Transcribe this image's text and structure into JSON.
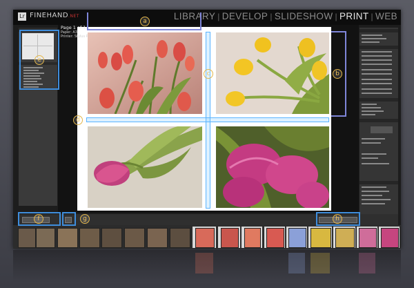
{
  "app": {
    "logo_mark": "Lr",
    "logo_text": "FINEHAND",
    "logo_suffix": ".NET"
  },
  "modules": [
    {
      "label": "LIBRARY",
      "active": false
    },
    {
      "label": "DEVELOP",
      "active": false
    },
    {
      "label": "SLIDESHOW",
      "active": false
    },
    {
      "label": "PRINT",
      "active": true
    },
    {
      "label": "WEB",
      "active": false
    }
  ],
  "page_info": {
    "page": "Page 1 of 1",
    "paper": "Paper: A3",
    "printer": "Printer: Stylus Pro 3800"
  },
  "callouts": [
    "a",
    "b",
    "c",
    "d",
    "e",
    "f",
    "g",
    "h"
  ],
  "colors": {
    "callout_border": "#3f8edd",
    "callout_badge": "#e3b64a",
    "active_module": "#e6e6e6"
  },
  "icons": {
    "flower_photos": "tulip-photo"
  }
}
